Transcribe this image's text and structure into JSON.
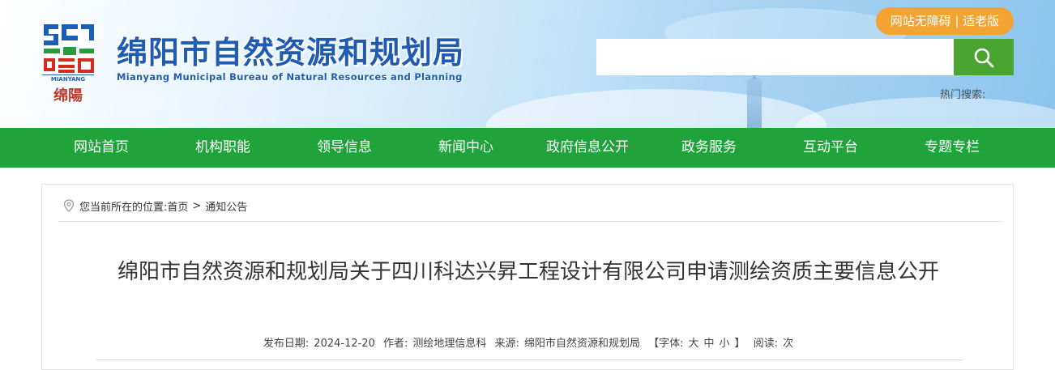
{
  "header": {
    "title": "绵阳市自然资源和规划局",
    "subtitle": "Mianyang Municipal Bureau of Natural Resources and Planning",
    "logo_text_en": "MIANYANG",
    "logo_text_cn": "绵陽",
    "accessibility_label": "网站无障碍 | 适老版",
    "search_placeholder": "",
    "hot_search_label": "热门搜索:"
  },
  "nav": {
    "items": [
      {
        "label": "网站首页"
      },
      {
        "label": "机构职能"
      },
      {
        "label": "领导信息"
      },
      {
        "label": "新闻中心"
      },
      {
        "label": "政府信息公开"
      },
      {
        "label": "政务服务"
      },
      {
        "label": "互动平台"
      },
      {
        "label": "专题专栏"
      }
    ]
  },
  "breadcrumb": {
    "prefix": "您当前所在的位置:",
    "home": "首页",
    "separator": ">",
    "current": "通知公告"
  },
  "article": {
    "title": "绵阳市自然资源和规划局关于四川科达兴昇工程设计有限公司申请测绘资质主要信息公开",
    "meta": {
      "date_label": "发布日期:",
      "date": "2024-12-20",
      "author_label": "作者:",
      "author": "测绘地理信息科",
      "source_label": "来源:",
      "source": "绵阳市自然资源和规划局",
      "font_open": "【字体:",
      "font_large": "大",
      "font_medium": "中",
      "font_small": "小",
      "font_close": "】",
      "reads_label": "阅读:",
      "reads_suffix": "次"
    }
  },
  "colors": {
    "nav_green": "#1fa33a",
    "search_green": "#4aa530",
    "accessibility_orange": "#f2a332",
    "title_blue": "#1f5bb0"
  },
  "icons": {
    "search": "search-icon",
    "location": "location-pin-icon",
    "logo": "mianyang-logo"
  }
}
